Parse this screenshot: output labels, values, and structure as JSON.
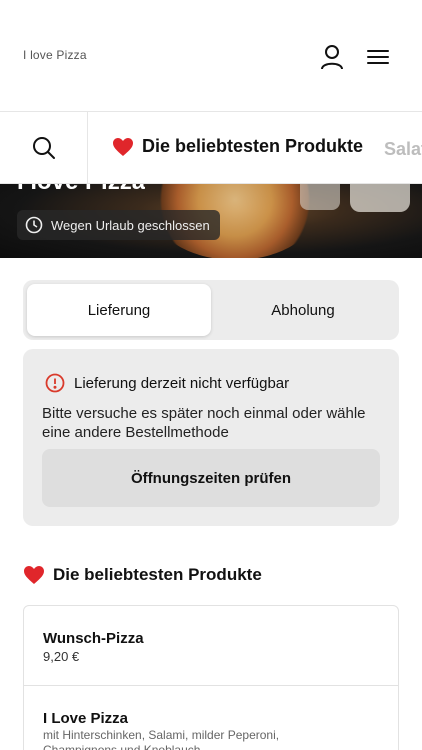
{
  "header": {
    "brand": "I love Pizza"
  },
  "category_bar": {
    "active_label": "Die beliebtesten Produkte",
    "next_label": "Salat"
  },
  "hero": {
    "title": "I love Pizza",
    "status": "Wegen Urlaub geschlossen"
  },
  "order_mode": {
    "options": [
      "Lieferung",
      "Abholung"
    ],
    "selected": "Lieferung"
  },
  "notice": {
    "title": "Lieferung derzeit nicht verfügbar",
    "body": "Bitte versuche es später noch einmal oder wähle eine andere Bestellmethode",
    "button": "Öffnungszeiten prüfen"
  },
  "section": {
    "title": "Die beliebtesten Produkte"
  },
  "products": [
    {
      "name": "Wunsch-Pizza",
      "price": "9,20 €"
    },
    {
      "name": "I Love Pizza",
      "description": "mit Hinterschinken, Salami, milder Peperoni, Champignons und Knoblauch"
    }
  ],
  "colors": {
    "heart": "#e0262b",
    "alert": "#d93a2b",
    "panel_bg": "#ececec"
  },
  "icons": {
    "user": "user-icon",
    "menu": "menu-icon",
    "search": "search-icon",
    "heart": "heart-icon",
    "clock": "clock-icon",
    "alert": "alert-circle-icon"
  }
}
